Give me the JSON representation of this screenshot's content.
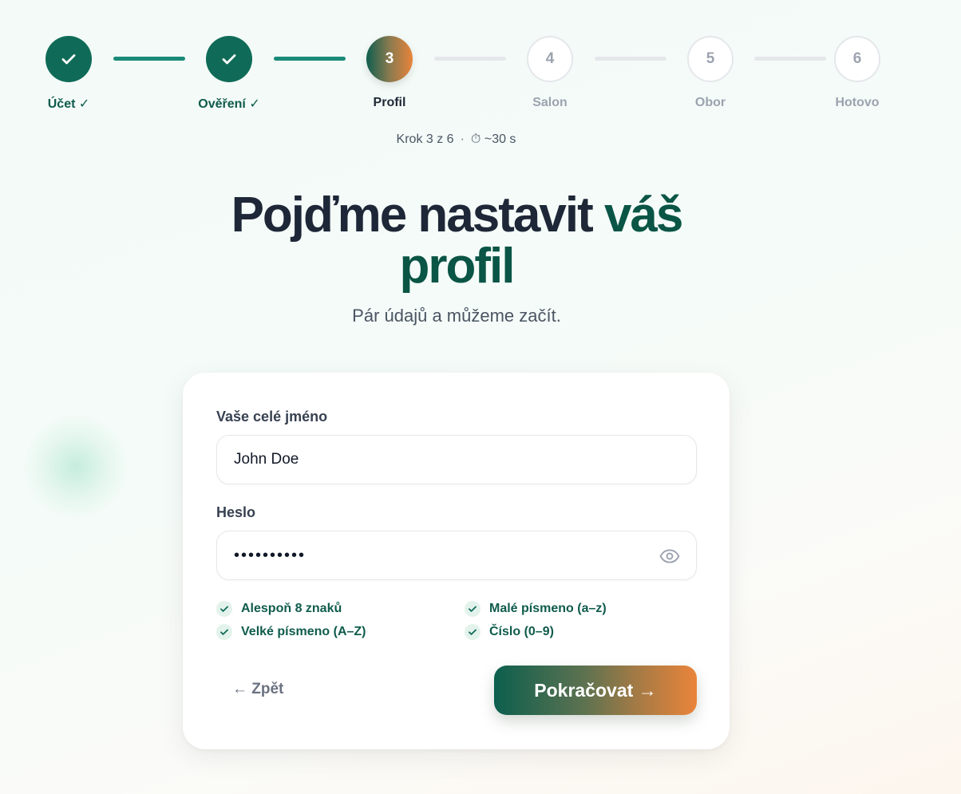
{
  "stepper": {
    "steps": [
      {
        "number": "1",
        "label": "Účet ✓",
        "state": "done"
      },
      {
        "number": "2",
        "label": "Ověření ✓",
        "state": "done"
      },
      {
        "number": "3",
        "label": "Profil",
        "state": "active"
      },
      {
        "number": "4",
        "label": "Salon",
        "state": "pending"
      },
      {
        "number": "5",
        "label": "Obor",
        "state": "pending"
      },
      {
        "number": "6",
        "label": "Hotovo",
        "state": "pending"
      }
    ],
    "progress_text": "Krok 3 z 6",
    "separator": "·",
    "time_icon": "stopwatch-icon",
    "time_glyph": "⏱",
    "time_text": "~30 s"
  },
  "heading": {
    "title_part1": "Pojďme nastavit ",
    "title_accent": "váš profil",
    "subtitle": "Pár údajů a můžeme začít."
  },
  "form": {
    "name_label": "Vaše celé jméno",
    "name_value": "John Doe",
    "password_label": "Heslo",
    "password_value": "••••••••••",
    "show_password_icon": "eye-icon",
    "requirements": [
      {
        "text": "Alespoň 8 znaků",
        "met": true
      },
      {
        "text": "Malé písmeno (a–z)",
        "met": true
      },
      {
        "text": "Velké písmeno (A–Z)",
        "met": true
      },
      {
        "text": "Číslo (0–9)",
        "met": true
      }
    ],
    "back_label": "← Zpět",
    "next_label": "Pokračovat →"
  },
  "colors": {
    "primary": "#0f6b57",
    "accent_orange": "#ea843a",
    "text_dark": "#1e2737",
    "muted": "#9ca3af"
  }
}
